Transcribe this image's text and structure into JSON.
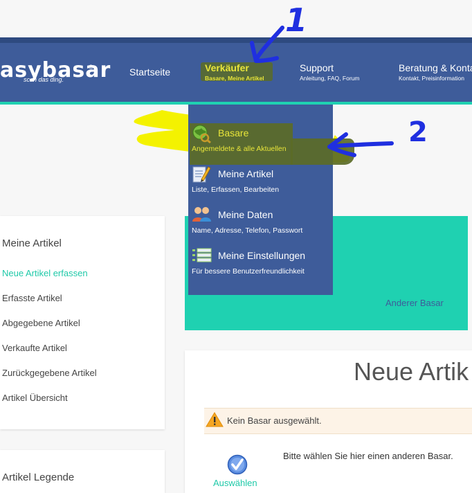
{
  "header": {
    "logo_text": "asybasar",
    "logo_reg": "®",
    "logo_tagline": "scan das ding.",
    "nav": [
      {
        "title": "Startseite",
        "sub": ""
      },
      {
        "title": "Verkäufer",
        "sub": "Basare, Meine Artikel"
      },
      {
        "title": "Support",
        "sub": "Anleitung, FAQ, Forum"
      },
      {
        "title": "Beratung & Konta",
        "sub": "Kontakt, Preisinformation"
      }
    ]
  },
  "dropdown": {
    "items": [
      {
        "title": "Basare",
        "sub": "Angemeldete & alle Aktuellen",
        "icon": "basare-globe-icon"
      },
      {
        "title": "Meine Artikel",
        "sub": "Liste, Erfassen, Bearbeiten",
        "icon": "edit-document-icon"
      },
      {
        "title": "Meine Daten",
        "sub": "Name, Adresse, Telefon, Passwort",
        "icon": "users-icon"
      },
      {
        "title": "Meine Einstellungen",
        "sub": "Für bessere Benutzerfreundlichkeit",
        "icon": "list-icon"
      }
    ]
  },
  "sidebar": {
    "title": "Meine Artikel",
    "items": [
      {
        "label": "Neue Artikel erfassen",
        "active": true
      },
      {
        "label": "Erfasste Artikel"
      },
      {
        "label": "Abgegebene Artikel"
      },
      {
        "label": "Verkaufte Artikel"
      },
      {
        "label": "Zurückgegebene Artikel"
      },
      {
        "label": "Artikel Übersicht"
      }
    ],
    "legend_title": "Artikel Legende"
  },
  "main": {
    "other_bazaar_link": "Anderer Basar",
    "title": "Neue Artik",
    "warning": "Kein Basar ausgewählt.",
    "instruction": "Bitte wählen Sie hier einen anderen Basar.",
    "select_label": "Auswählen"
  },
  "annotations": {
    "marker_1": "1",
    "marker_2": "2"
  },
  "colors": {
    "nav_bg": "#3e5c9a",
    "accent_teal": "#1fd1b1",
    "highlight_yellow": "#e8e53a",
    "annotation_blue": "#1f2fe0"
  }
}
